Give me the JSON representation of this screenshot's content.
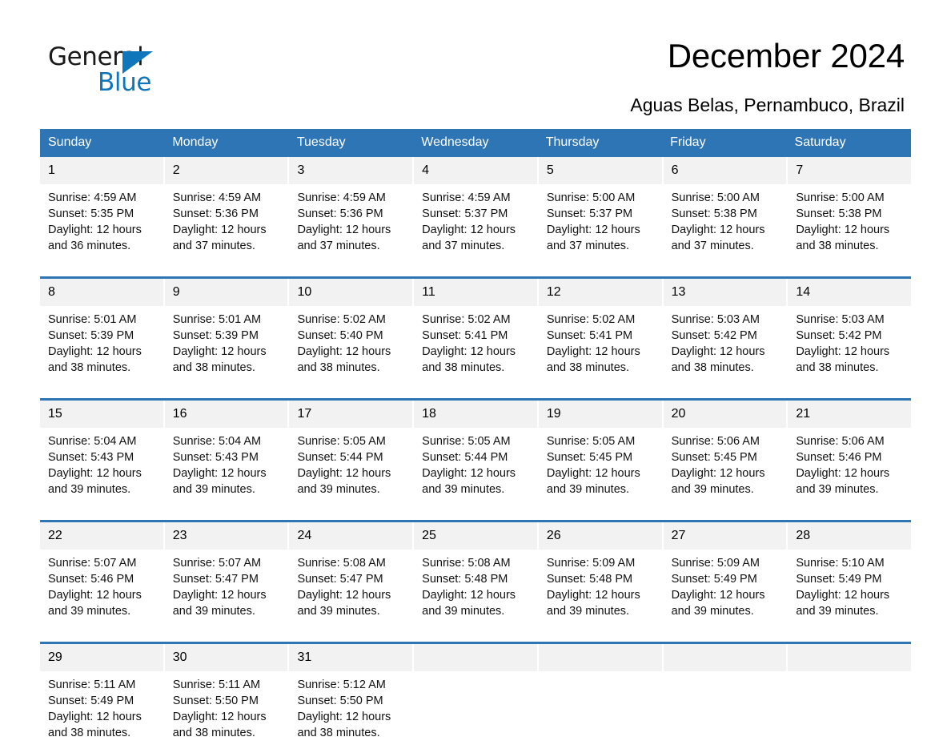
{
  "logo": {
    "word1": "General",
    "word2": "Blue",
    "triangle_color": "#0f76bc"
  },
  "header": {
    "title": "December 2024",
    "location": "Aguas Belas, Pernambuco, Brazil"
  },
  "colors": {
    "header_blue": "#2e75b6",
    "day_number_bg": "#f2f2f2",
    "text": "#000000"
  },
  "calendar": {
    "weekdays": [
      "Sunday",
      "Monday",
      "Tuesday",
      "Wednesday",
      "Thursday",
      "Friday",
      "Saturday"
    ],
    "weeks": [
      [
        {
          "day": "1",
          "sunrise": "Sunrise: 4:59 AM",
          "sunset": "Sunset: 5:35 PM",
          "daylight_1": "Daylight: 12 hours",
          "daylight_2": "and 36 minutes."
        },
        {
          "day": "2",
          "sunrise": "Sunrise: 4:59 AM",
          "sunset": "Sunset: 5:36 PM",
          "daylight_1": "Daylight: 12 hours",
          "daylight_2": "and 37 minutes."
        },
        {
          "day": "3",
          "sunrise": "Sunrise: 4:59 AM",
          "sunset": "Sunset: 5:36 PM",
          "daylight_1": "Daylight: 12 hours",
          "daylight_2": "and 37 minutes."
        },
        {
          "day": "4",
          "sunrise": "Sunrise: 4:59 AM",
          "sunset": "Sunset: 5:37 PM",
          "daylight_1": "Daylight: 12 hours",
          "daylight_2": "and 37 minutes."
        },
        {
          "day": "5",
          "sunrise": "Sunrise: 5:00 AM",
          "sunset": "Sunset: 5:37 PM",
          "daylight_1": "Daylight: 12 hours",
          "daylight_2": "and 37 minutes."
        },
        {
          "day": "6",
          "sunrise": "Sunrise: 5:00 AM",
          "sunset": "Sunset: 5:38 PM",
          "daylight_1": "Daylight: 12 hours",
          "daylight_2": "and 37 minutes."
        },
        {
          "day": "7",
          "sunrise": "Sunrise: 5:00 AM",
          "sunset": "Sunset: 5:38 PM",
          "daylight_1": "Daylight: 12 hours",
          "daylight_2": "and 38 minutes."
        }
      ],
      [
        {
          "day": "8",
          "sunrise": "Sunrise: 5:01 AM",
          "sunset": "Sunset: 5:39 PM",
          "daylight_1": "Daylight: 12 hours",
          "daylight_2": "and 38 minutes."
        },
        {
          "day": "9",
          "sunrise": "Sunrise: 5:01 AM",
          "sunset": "Sunset: 5:39 PM",
          "daylight_1": "Daylight: 12 hours",
          "daylight_2": "and 38 minutes."
        },
        {
          "day": "10",
          "sunrise": "Sunrise: 5:02 AM",
          "sunset": "Sunset: 5:40 PM",
          "daylight_1": "Daylight: 12 hours",
          "daylight_2": "and 38 minutes."
        },
        {
          "day": "11",
          "sunrise": "Sunrise: 5:02 AM",
          "sunset": "Sunset: 5:41 PM",
          "daylight_1": "Daylight: 12 hours",
          "daylight_2": "and 38 minutes."
        },
        {
          "day": "12",
          "sunrise": "Sunrise: 5:02 AM",
          "sunset": "Sunset: 5:41 PM",
          "daylight_1": "Daylight: 12 hours",
          "daylight_2": "and 38 minutes."
        },
        {
          "day": "13",
          "sunrise": "Sunrise: 5:03 AM",
          "sunset": "Sunset: 5:42 PM",
          "daylight_1": "Daylight: 12 hours",
          "daylight_2": "and 38 minutes."
        },
        {
          "day": "14",
          "sunrise": "Sunrise: 5:03 AM",
          "sunset": "Sunset: 5:42 PM",
          "daylight_1": "Daylight: 12 hours",
          "daylight_2": "and 38 minutes."
        }
      ],
      [
        {
          "day": "15",
          "sunrise": "Sunrise: 5:04 AM",
          "sunset": "Sunset: 5:43 PM",
          "daylight_1": "Daylight: 12 hours",
          "daylight_2": "and 39 minutes."
        },
        {
          "day": "16",
          "sunrise": "Sunrise: 5:04 AM",
          "sunset": "Sunset: 5:43 PM",
          "daylight_1": "Daylight: 12 hours",
          "daylight_2": "and 39 minutes."
        },
        {
          "day": "17",
          "sunrise": "Sunrise: 5:05 AM",
          "sunset": "Sunset: 5:44 PM",
          "daylight_1": "Daylight: 12 hours",
          "daylight_2": "and 39 minutes."
        },
        {
          "day": "18",
          "sunrise": "Sunrise: 5:05 AM",
          "sunset": "Sunset: 5:44 PM",
          "daylight_1": "Daylight: 12 hours",
          "daylight_2": "and 39 minutes."
        },
        {
          "day": "19",
          "sunrise": "Sunrise: 5:05 AM",
          "sunset": "Sunset: 5:45 PM",
          "daylight_1": "Daylight: 12 hours",
          "daylight_2": "and 39 minutes."
        },
        {
          "day": "20",
          "sunrise": "Sunrise: 5:06 AM",
          "sunset": "Sunset: 5:45 PM",
          "daylight_1": "Daylight: 12 hours",
          "daylight_2": "and 39 minutes."
        },
        {
          "day": "21",
          "sunrise": "Sunrise: 5:06 AM",
          "sunset": "Sunset: 5:46 PM",
          "daylight_1": "Daylight: 12 hours",
          "daylight_2": "and 39 minutes."
        }
      ],
      [
        {
          "day": "22",
          "sunrise": "Sunrise: 5:07 AM",
          "sunset": "Sunset: 5:46 PM",
          "daylight_1": "Daylight: 12 hours",
          "daylight_2": "and 39 minutes."
        },
        {
          "day": "23",
          "sunrise": "Sunrise: 5:07 AM",
          "sunset": "Sunset: 5:47 PM",
          "daylight_1": "Daylight: 12 hours",
          "daylight_2": "and 39 minutes."
        },
        {
          "day": "24",
          "sunrise": "Sunrise: 5:08 AM",
          "sunset": "Sunset: 5:47 PM",
          "daylight_1": "Daylight: 12 hours",
          "daylight_2": "and 39 minutes."
        },
        {
          "day": "25",
          "sunrise": "Sunrise: 5:08 AM",
          "sunset": "Sunset: 5:48 PM",
          "daylight_1": "Daylight: 12 hours",
          "daylight_2": "and 39 minutes."
        },
        {
          "day": "26",
          "sunrise": "Sunrise: 5:09 AM",
          "sunset": "Sunset: 5:48 PM",
          "daylight_1": "Daylight: 12 hours",
          "daylight_2": "and 39 minutes."
        },
        {
          "day": "27",
          "sunrise": "Sunrise: 5:09 AM",
          "sunset": "Sunset: 5:49 PM",
          "daylight_1": "Daylight: 12 hours",
          "daylight_2": "and 39 minutes."
        },
        {
          "day": "28",
          "sunrise": "Sunrise: 5:10 AM",
          "sunset": "Sunset: 5:49 PM",
          "daylight_1": "Daylight: 12 hours",
          "daylight_2": "and 39 minutes."
        }
      ],
      [
        {
          "day": "29",
          "sunrise": "Sunrise: 5:11 AM",
          "sunset": "Sunset: 5:49 PM",
          "daylight_1": "Daylight: 12 hours",
          "daylight_2": "and 38 minutes."
        },
        {
          "day": "30",
          "sunrise": "Sunrise: 5:11 AM",
          "sunset": "Sunset: 5:50 PM",
          "daylight_1": "Daylight: 12 hours",
          "daylight_2": "and 38 minutes."
        },
        {
          "day": "31",
          "sunrise": "Sunrise: 5:12 AM",
          "sunset": "Sunset: 5:50 PM",
          "daylight_1": "Daylight: 12 hours",
          "daylight_2": "and 38 minutes."
        },
        {
          "day": "",
          "sunrise": "",
          "sunset": "",
          "daylight_1": "",
          "daylight_2": ""
        },
        {
          "day": "",
          "sunrise": "",
          "sunset": "",
          "daylight_1": "",
          "daylight_2": ""
        },
        {
          "day": "",
          "sunrise": "",
          "sunset": "",
          "daylight_1": "",
          "daylight_2": ""
        },
        {
          "day": "",
          "sunrise": "",
          "sunset": "",
          "daylight_1": "",
          "daylight_2": ""
        }
      ]
    ]
  }
}
